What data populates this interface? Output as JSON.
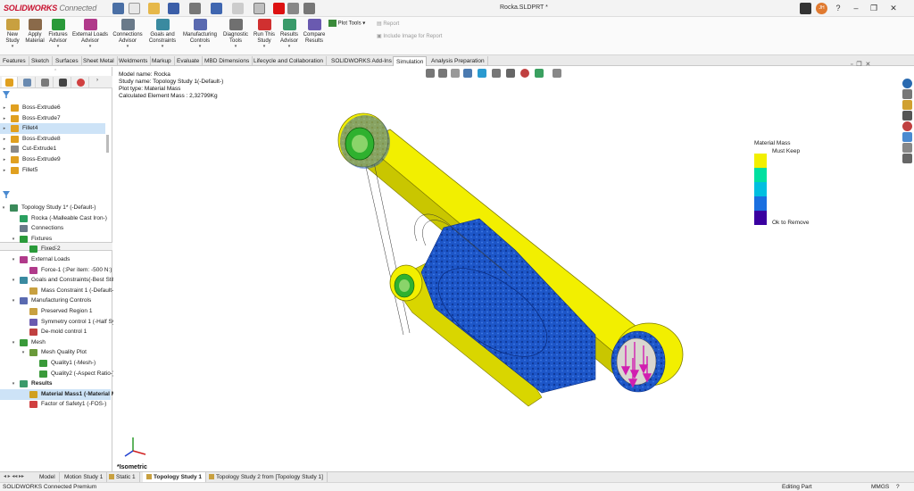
{
  "app": {
    "logo_main": "SOLIDWORKS",
    "logo_sub": "Connected",
    "doc_title": "Rocka.SLDPRT *",
    "user_initials": "JH"
  },
  "ribbon": {
    "items": [
      {
        "label": "New\nStudy",
        "icon": "new-study-icon"
      },
      {
        "label": "Apply\nMaterial",
        "icon": "apply-material-icon"
      },
      {
        "label": "Fixtures\nAdvisor",
        "icon": "fixtures-advisor-icon"
      },
      {
        "label": "External Loads\nAdvisor",
        "icon": "external-loads-icon"
      },
      {
        "label": "Connections\nAdvisor",
        "icon": "connections-advisor-icon"
      },
      {
        "label": "Goals and\nConstraints",
        "icon": "goals-constraints-icon"
      },
      {
        "label": "Manufacturing\nControls",
        "icon": "manufacturing-controls-icon"
      },
      {
        "label": "Diagnostic\nTools",
        "icon": "diagnostic-tools-icon"
      },
      {
        "label": "Run This\nStudy",
        "icon": "run-study-icon"
      },
      {
        "label": "Results\nAdvisor",
        "icon": "results-advisor-icon"
      },
      {
        "label": "Compare\nResults",
        "icon": "compare-results-icon"
      },
      {
        "label": "Plot Tools",
        "icon": "plot-tools-icon"
      }
    ],
    "report": "Report",
    "include_image": "Include Image for Report"
  },
  "tabs": [
    "Features",
    "Sketch",
    "Surfaces",
    "Sheet Metal",
    "Weldments",
    "Markup",
    "Evaluate",
    "MBD Dimensions",
    "Lifecycle and Collaboration",
    "SOLIDWORKS Add-Ins",
    "Simulation",
    "Analysis Preparation"
  ],
  "active_tab": "Simulation",
  "feature_tree": [
    {
      "label": "Boss-Extrude6"
    },
    {
      "label": "Boss-Extrude7"
    },
    {
      "label": "Fillet4"
    },
    {
      "label": "Boss-Extrude8"
    },
    {
      "label": "Cut-Extrude1"
    },
    {
      "label": "Boss-Extrude9"
    },
    {
      "label": "Fillet5"
    }
  ],
  "study_tree": [
    {
      "label": "Topology Study 1* (-Default-)",
      "level": 0
    },
    {
      "label": "Rocka (-Malleable Cast Iron-)",
      "level": 1
    },
    {
      "label": "Connections",
      "level": 1
    },
    {
      "label": "Fixtures",
      "level": 1
    },
    {
      "label": "Fixed-2",
      "level": 2
    },
    {
      "label": "External Loads",
      "level": 1
    },
    {
      "label": "Force-1 (:Per item: -500 N:)",
      "level": 2
    },
    {
      "label": "Goals and Constraints(-Best Stiffne",
      "level": 1
    },
    {
      "label": "Mass Constraint 1 (-Default-)",
      "level": 2
    },
    {
      "label": "Manufacturing Controls",
      "level": 1
    },
    {
      "label": "Preserved Region 1",
      "level": 2
    },
    {
      "label": "Symmetry control 1 (-Half Sym",
      "level": 2
    },
    {
      "label": "De-mold control 1",
      "level": 2
    },
    {
      "label": "Mesh",
      "level": 1
    },
    {
      "label": "Mesh Quality Plot",
      "level": 2
    },
    {
      "label": "Quality1 (-Mesh-)",
      "level": 3
    },
    {
      "label": "Quality2 (-Aspect Ratio-)",
      "level": 3
    },
    {
      "label": "Results",
      "level": 1
    },
    {
      "label": "Material Mass1 (-Material Ma",
      "level": 2
    },
    {
      "label": "Factor of Safety1 (-FOS-)",
      "level": 2
    }
  ],
  "viewport": {
    "model_name": "Model name: Rocka",
    "study_name": "Study name: Topology Study 1(-Default-)",
    "plot_type": "Plot type: Material Mass",
    "mass": "Calculated Element Mass : 2,32799Kg",
    "view_label": "*Isometric"
  },
  "legend": {
    "title": "Material Mass",
    "top_label": "Must Keep",
    "bottom_label": "Ok to Remove",
    "colors": [
      "#f2ef00",
      "#00e0a0",
      "#00bfe0",
      "#1a6fe0",
      "#3a00a0"
    ]
  },
  "bottom_tabs": [
    "Model",
    "Motion Study 1",
    "Static 1",
    "Topology Study 1",
    "Topology Study 2 from [Topology Study 1]"
  ],
  "active_bottom_tab": "Topology Study 1",
  "status": {
    "left": "SOLIDWORKS Connected Premium",
    "mode": "Editing Part",
    "units": "MMGS"
  }
}
